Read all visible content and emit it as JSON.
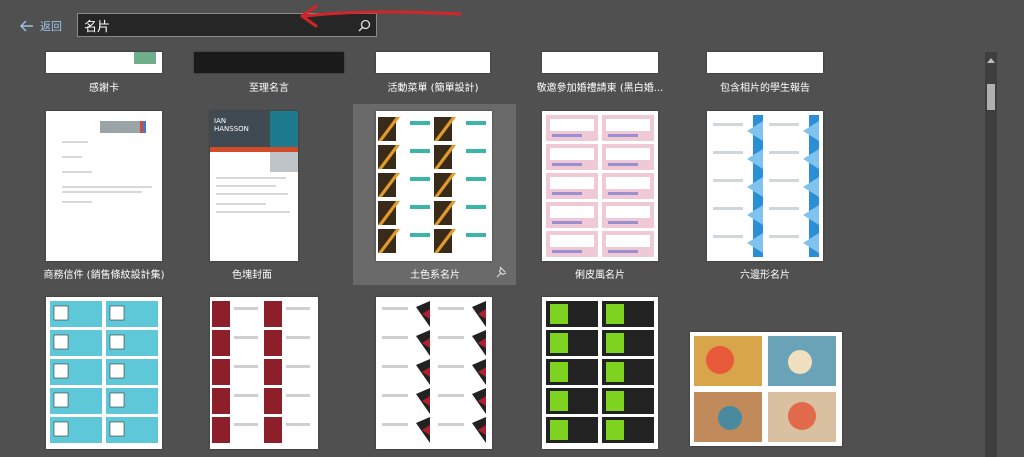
{
  "header": {
    "back_label": "返回",
    "search_value": "名片"
  },
  "templates_row1": [
    "感謝卡",
    "至理名言",
    "活動菜單 (簡單設計)",
    "敬邀參加婚禮請柬 (黑白婚...",
    "包含相片的學生報告"
  ],
  "templates_row2": [
    "商務信件 (銷售條紋設計集)",
    "色塊封面",
    "土色系名片",
    "俐皮風名片",
    "六邊形名片"
  ],
  "cv_sample": {
    "name_line1": "IAN",
    "name_line2": "HANSSON"
  },
  "colors": {
    "background": "#505050",
    "accent_link": "#9fc3e6",
    "annotation_arrow": "#d0262a",
    "selected_tile": "#6a6a6a"
  }
}
